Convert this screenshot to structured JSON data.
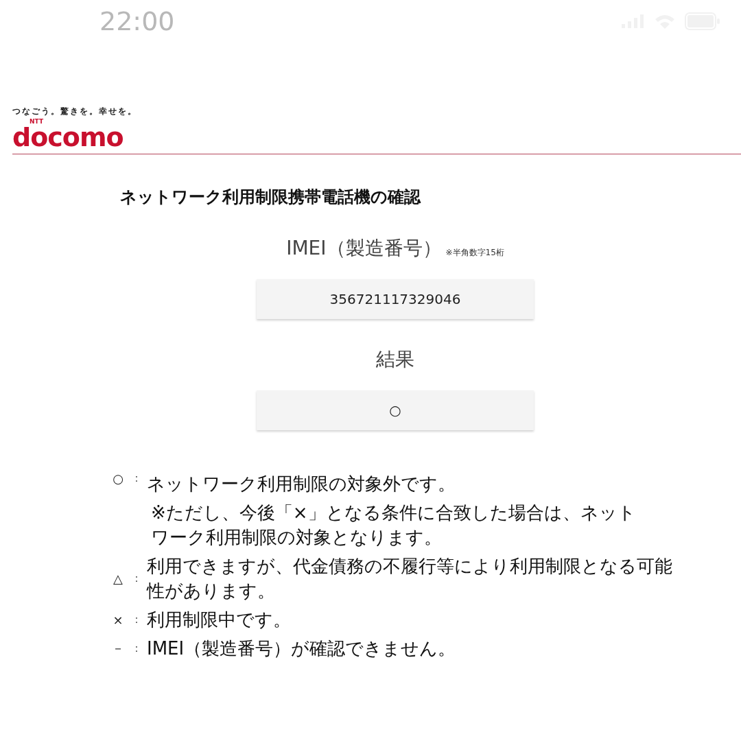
{
  "status_bar": {
    "time": "22:00"
  },
  "header": {
    "tagline": "つなごう。驚きを。幸せを。",
    "brand_small": "NTT",
    "brand": "docomo"
  },
  "title": "ネットワーク利用制限携帯電話機の確認",
  "imei": {
    "label": "IMEI（製造番号）",
    "note": "※半角数字15桁",
    "value": "356721117329046"
  },
  "result": {
    "label": "結果",
    "value": "○"
  },
  "legend": [
    {
      "symbol": "○",
      "separator": "：",
      "text": "ネットワーク利用制限の対象外です。",
      "note": "※ただし、今後「×」となる条件に合致した場合は、ネットワーク利用制限の対象となります。"
    },
    {
      "symbol": "△",
      "separator": "：",
      "text": "利用できますが、代金債務の不履行等により利用制限となる可能性があります。"
    },
    {
      "symbol": "×",
      "separator": "：",
      "text": "利用制限中です。"
    },
    {
      "symbol": "－",
      "separator": "：",
      "text": "IMEI（製造番号）が確認できません。"
    }
  ]
}
